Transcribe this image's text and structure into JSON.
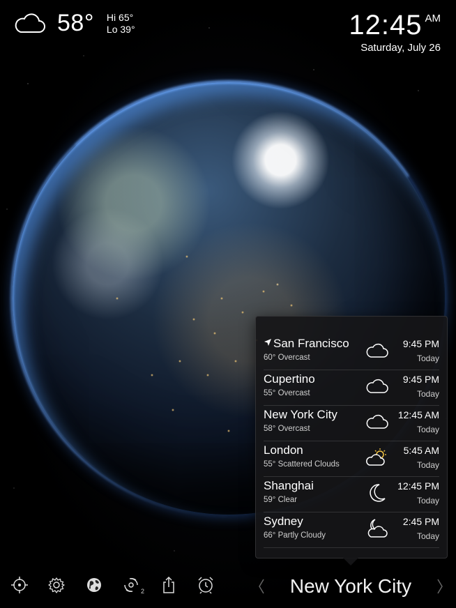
{
  "current": {
    "temperature": "58°",
    "hi": "Hi  65°",
    "lo": "Lo  39°",
    "icon": "cloud-icon"
  },
  "clock": {
    "time": "12:45",
    "ampm": "AM",
    "date": "Saturday, July 26"
  },
  "cities": [
    {
      "name": "San Francisco",
      "condition": "60° Overcast",
      "time": "9:45 PM",
      "day": "Today",
      "icon": "cloud-icon",
      "current_location": true
    },
    {
      "name": "Cupertino",
      "condition": "55° Overcast",
      "time": "9:45 PM",
      "day": "Today",
      "icon": "cloud-icon"
    },
    {
      "name": "New York City",
      "condition": "58° Overcast",
      "time": "12:45 AM",
      "day": "Today",
      "icon": "cloud-icon"
    },
    {
      "name": "London",
      "condition": "55° Scattered Clouds",
      "time": "5:45 AM",
      "day": "Today",
      "icon": "sun-cloud-icon"
    },
    {
      "name": "Shanghai",
      "condition": "59° Clear",
      "time": "12:45 PM",
      "day": "Today",
      "icon": "moon-icon"
    },
    {
      "name": "Sydney",
      "condition": "66° Partly Cloudy",
      "time": "2:45 PM",
      "day": "Today",
      "icon": "moon-cloud-icon"
    }
  ],
  "toolbar": {
    "items": [
      "location-target-icon",
      "gear-icon",
      "globe-icon",
      "hurricane-icon",
      "share-icon",
      "alarm-clock-icon"
    ],
    "hurricane_badge": "2",
    "selected_city": "New York City"
  },
  "colors": {
    "background": "#000000",
    "popover_bg": "#161618",
    "city_light": "#ffd27a",
    "atmosphere": "#6eaaff"
  }
}
